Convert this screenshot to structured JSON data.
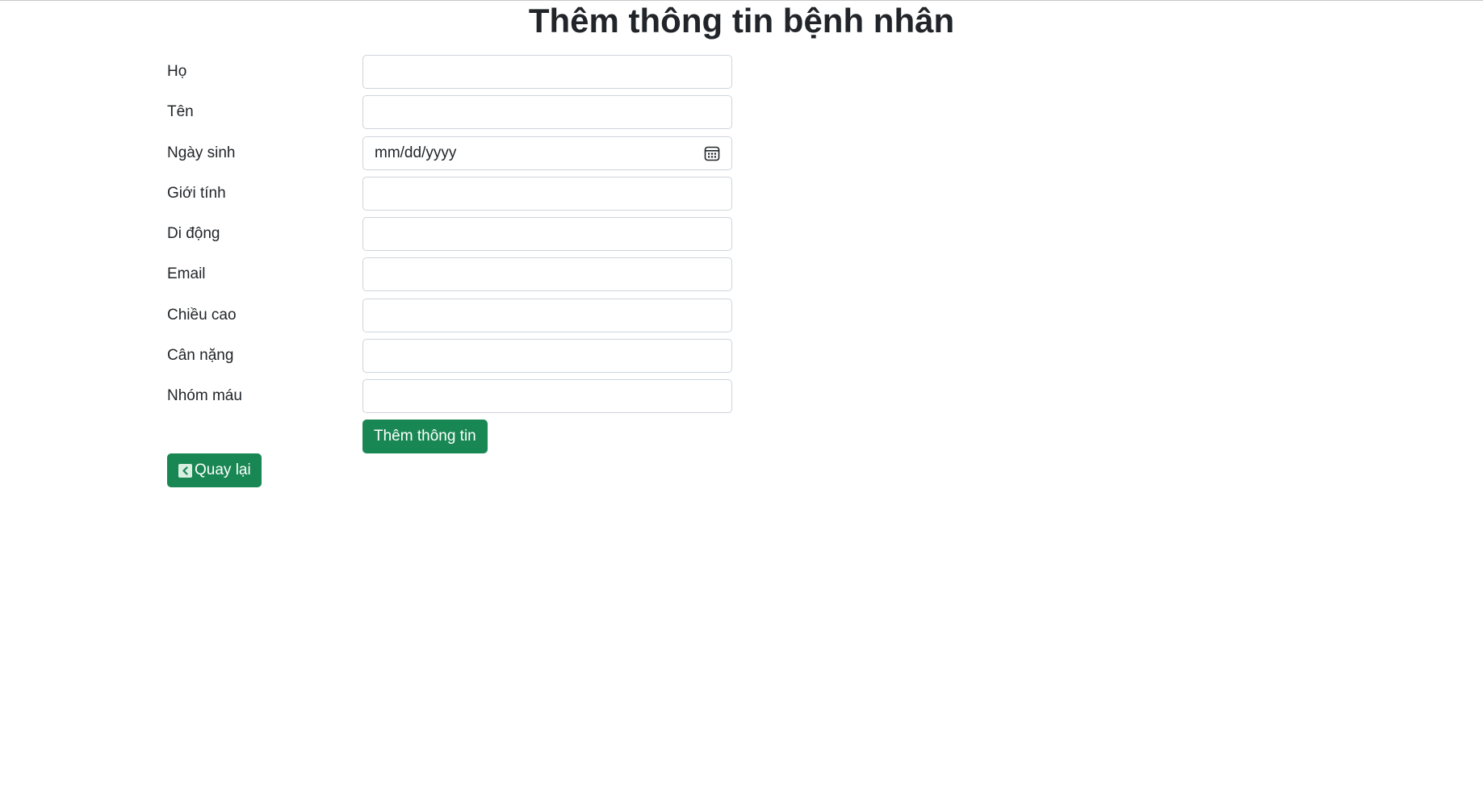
{
  "page": {
    "title": "Thêm thông tin bệnh nhân"
  },
  "form": {
    "fields": [
      {
        "label": "Họ",
        "value": ""
      },
      {
        "label": "Tên",
        "value": ""
      },
      {
        "label": "Ngày sinh",
        "placeholder": "mm/dd/yyyy",
        "icon": "calendar-icon"
      },
      {
        "label": "Giới tính",
        "value": ""
      },
      {
        "label": "Di động",
        "value": ""
      },
      {
        "label": "Email",
        "value": ""
      },
      {
        "label": "Chiều cao",
        "value": ""
      },
      {
        "label": "Cân nặng",
        "value": ""
      },
      {
        "label": "Nhóm máu",
        "value": ""
      }
    ],
    "submit_label": "Thêm thông tin"
  },
  "back_button": {
    "label": "Quay lại",
    "icon": "chevron-left-icon"
  },
  "colors": {
    "primary_button": "#198754",
    "input_border": "#ced4da",
    "text": "#212529"
  }
}
